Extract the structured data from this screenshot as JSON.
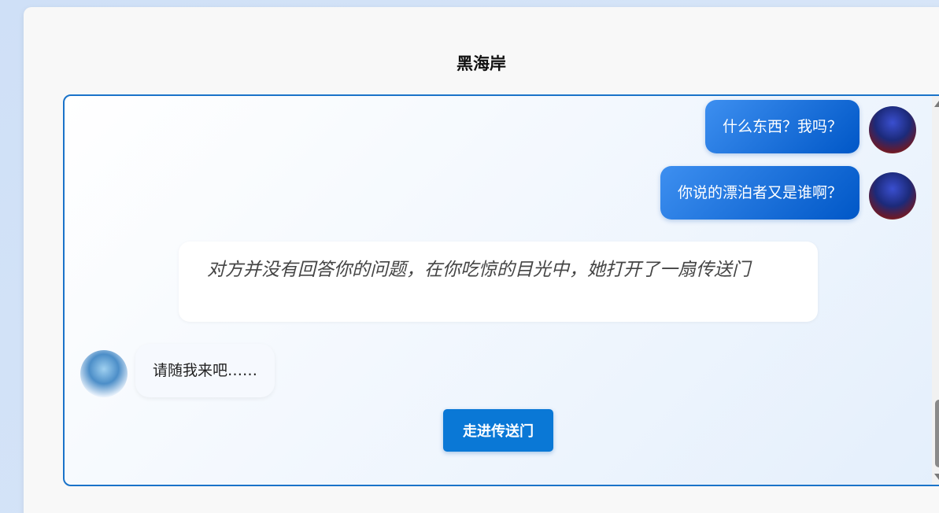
{
  "header": {
    "title": "黑海岸"
  },
  "messages": {
    "user_1": "什么东西？我吗？",
    "user_2": "你说的漂泊者又是谁啊？",
    "narration": "对方并没有回答你的问题，在你吃惊的目光中，她打开了一扇传送门",
    "bot_1": "请随我来吧……"
  },
  "actions": {
    "enter_portal": "走进传送门"
  },
  "colors": {
    "accent": "#0a78d6",
    "user_bubble": "#1a6fe0",
    "border": "#1a73c9"
  }
}
